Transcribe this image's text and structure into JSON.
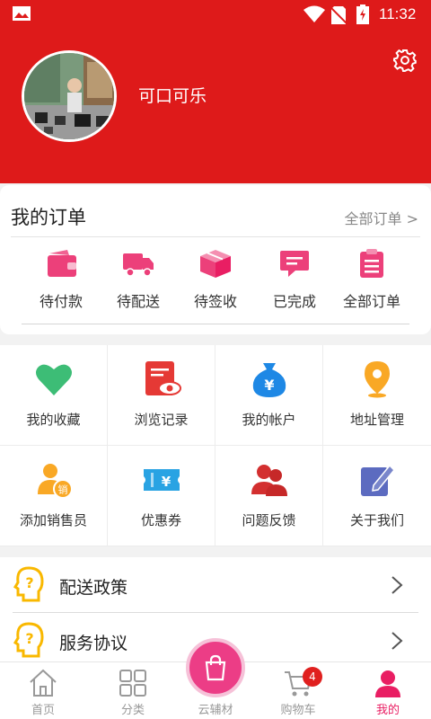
{
  "status_bar": {
    "time": "11:32"
  },
  "profile": {
    "username": "可口可乐"
  },
  "orders": {
    "title": "我的订单",
    "all_link": "全部订单 >",
    "items": [
      {
        "label": "待付款",
        "icon": "wallet-icon"
      },
      {
        "label": "待配送",
        "icon": "truck-icon"
      },
      {
        "label": "待签收",
        "icon": "package-icon"
      },
      {
        "label": "已完成",
        "icon": "message-icon"
      },
      {
        "label": "全部订单",
        "icon": "clipboard-icon"
      }
    ]
  },
  "grid": [
    {
      "label": "我的收藏",
      "icon": "heart-icon"
    },
    {
      "label": "浏览记录",
      "icon": "history-icon"
    },
    {
      "label": "我的帐户",
      "icon": "money-bag-icon"
    },
    {
      "label": "地址管理",
      "icon": "location-pin-icon"
    },
    {
      "label": "添加销售员",
      "icon": "salesperson-icon"
    },
    {
      "label": "优惠券",
      "icon": "coupon-icon"
    },
    {
      "label": "问题反馈",
      "icon": "feedback-users-icon"
    },
    {
      "label": "关于我们",
      "icon": "edit-icon"
    }
  ],
  "list": [
    {
      "label": "配送政策",
      "icon": "question-head-icon"
    },
    {
      "label": "服务协议",
      "icon": "question-head-icon"
    }
  ],
  "nav": {
    "tabs": [
      {
        "label": "首页",
        "icon": "home-icon"
      },
      {
        "label": "分类",
        "icon": "grid-icon"
      },
      {
        "label": "云辅材",
        "icon": "shopping-bag-icon"
      },
      {
        "label": "购物车",
        "icon": "cart-icon"
      },
      {
        "label": "我的",
        "icon": "user-icon"
      }
    ],
    "cart_badge": "4",
    "active_tab": "我的"
  },
  "colors": {
    "brand_red": "#de1a1a",
    "accent_pink": "#e91e63",
    "center_button": "#ec3d86"
  }
}
